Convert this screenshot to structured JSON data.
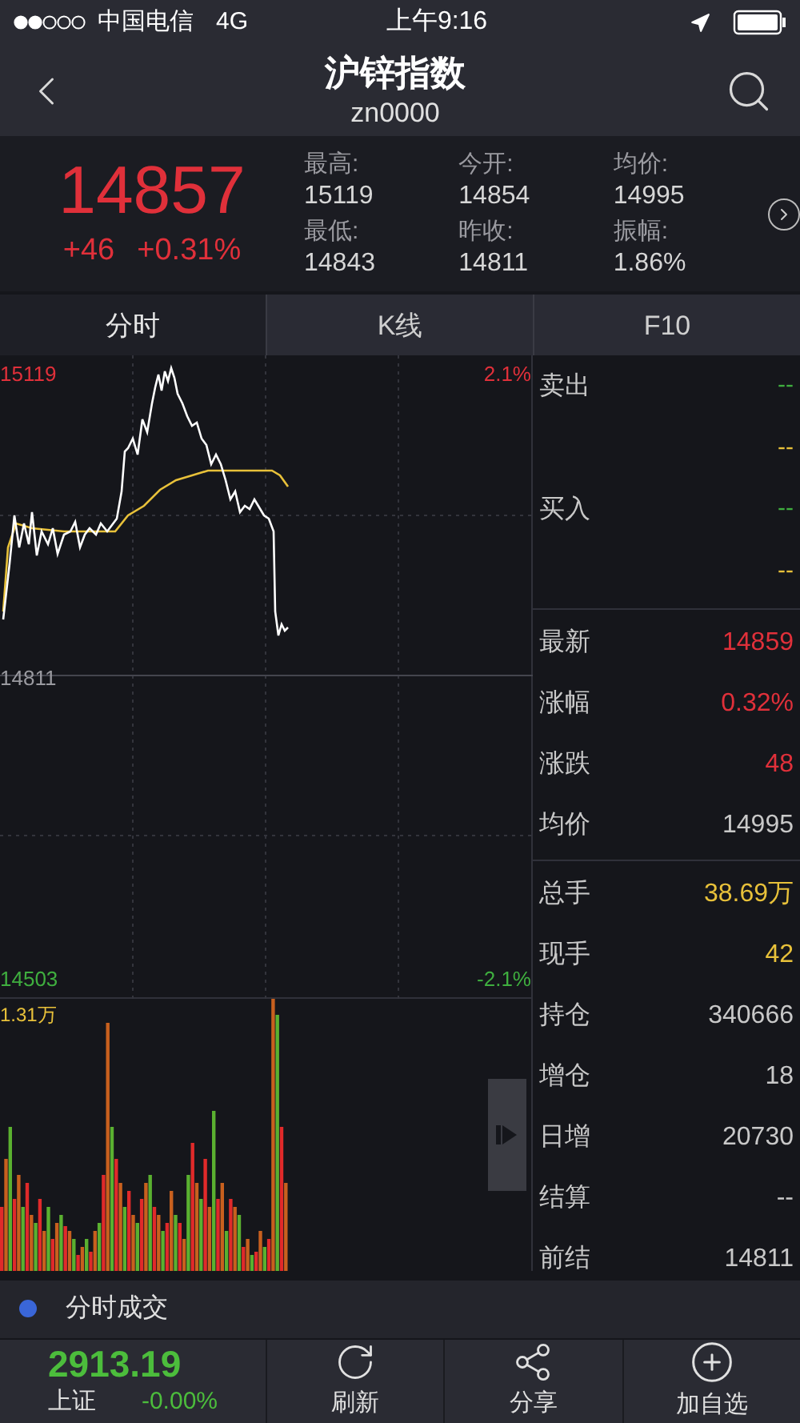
{
  "status_bar": {
    "carrier": "中国电信",
    "network": "4G",
    "time": "上午9:16"
  },
  "nav": {
    "title": "沪锌指数",
    "code": "zn0000"
  },
  "quote": {
    "price": "14857",
    "change": "+46",
    "change_pct": "+0.31%",
    "stats": [
      {
        "label": "最高:",
        "value": "15119"
      },
      {
        "label": "今开:",
        "value": "14854"
      },
      {
        "label": "均价:",
        "value": "14995"
      },
      {
        "label": "最低:",
        "value": "14843"
      },
      {
        "label": "昨收:",
        "value": "14811"
      },
      {
        "label": "振幅:",
        "value": "1.86%"
      }
    ]
  },
  "tabs": [
    {
      "label": "分时",
      "selected": true
    },
    {
      "label": "K线",
      "selected": false
    },
    {
      "label": "F10",
      "selected": false
    }
  ],
  "chart_labels": {
    "high": "15119",
    "high_pct": "2.1%",
    "mid": "14811",
    "low": "14503",
    "low_pct": "-2.1%",
    "volume_max": "1.31万"
  },
  "order_book": [
    {
      "label": "卖出",
      "values": [
        {
          "text": "--",
          "color": "#3fae3f"
        },
        {
          "text": "--",
          "color": "#e8c13a"
        }
      ]
    },
    {
      "label": "买入",
      "values": [
        {
          "text": "--",
          "color": "#3fae3f"
        },
        {
          "text": "--",
          "color": "#e8c13a"
        }
      ]
    }
  ],
  "stat_groups": [
    [
      {
        "label": "最新",
        "value": "14859",
        "color": "#e0303a"
      },
      {
        "label": "涨幅",
        "value": "0.32%",
        "color": "#e0303a"
      },
      {
        "label": "涨跌",
        "value": "48",
        "color": "#e0303a"
      },
      {
        "label": "均价",
        "value": "14995",
        "color": "#c8c8c8"
      }
    ],
    [
      {
        "label": "总手",
        "value": "38.69万",
        "color": "#e8c13a"
      },
      {
        "label": "现手",
        "value": "42",
        "color": "#e8c13a"
      },
      {
        "label": "持仓",
        "value": "340666",
        "color": "#c8c8c8"
      },
      {
        "label": "增仓",
        "value": "18",
        "color": "#c8c8c8"
      },
      {
        "label": "日增",
        "value": "20730",
        "color": "#c8c8c8"
      },
      {
        "label": "结算",
        "value": "--",
        "color": "#c8c8c8"
      },
      {
        "label": "前结",
        "value": "14811",
        "color": "#c8c8c8"
      }
    ]
  ],
  "section": {
    "title": "分时成交"
  },
  "bottom_bar": {
    "index_value": "2913.19",
    "index_name": "上证",
    "index_change": "-0.00%",
    "actions": [
      {
        "kind": "refresh",
        "label": "刷新"
      },
      {
        "kind": "share",
        "label": "分享"
      },
      {
        "kind": "add",
        "label": "加自选"
      }
    ]
  }
}
